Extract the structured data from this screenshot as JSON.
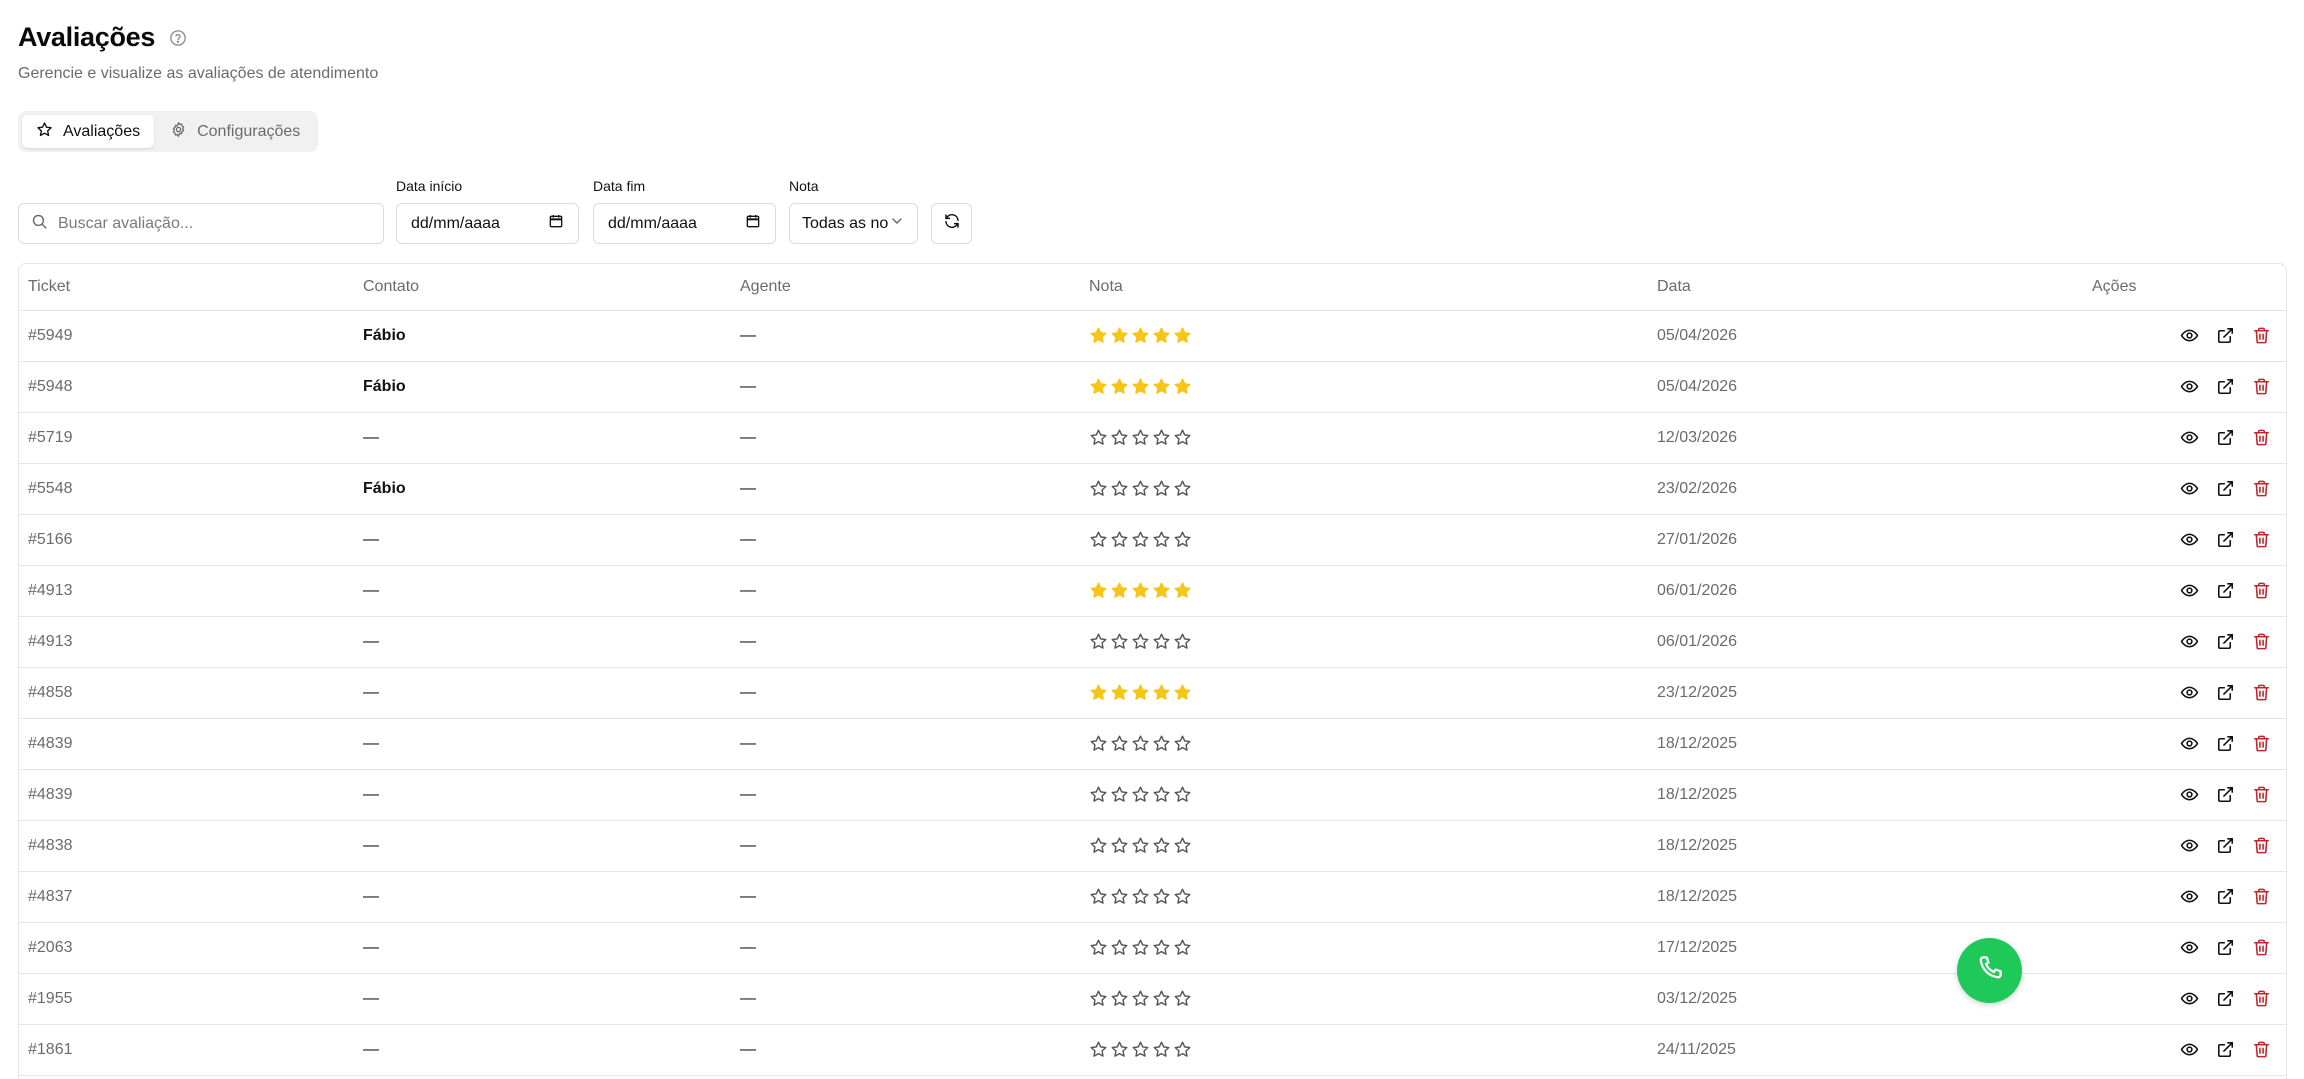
{
  "header": {
    "title": "Avaliações",
    "subtitle": "Gerencie e visualize as avaliações de atendimento"
  },
  "tabs": [
    {
      "label": "Avaliações",
      "icon": "star-icon",
      "active": true
    },
    {
      "label": "Configurações",
      "icon": "gear-icon",
      "active": false
    }
  ],
  "filters": {
    "search_placeholder": "Buscar avaliação...",
    "start_date": {
      "label": "Data início",
      "value": "dd/mm/aaaa"
    },
    "end_date": {
      "label": "Data fim",
      "value": "dd/mm/aaaa"
    },
    "rating": {
      "label": "Nota",
      "value": "Todas as no"
    }
  },
  "table": {
    "columns": [
      "Ticket",
      "Contato",
      "Agente",
      "Nota",
      "Data",
      "Ações"
    ],
    "rows": [
      {
        "ticket": "#5949",
        "contact": "Fábio",
        "agent": "—",
        "rating": 5,
        "date": "05/04/2026"
      },
      {
        "ticket": "#5948",
        "contact": "Fábio",
        "agent": "—",
        "rating": 5,
        "date": "05/04/2026"
      },
      {
        "ticket": "#5719",
        "contact": "—",
        "agent": "—",
        "rating": 0,
        "date": "12/03/2026"
      },
      {
        "ticket": "#5548",
        "contact": "Fábio",
        "agent": "—",
        "rating": 0,
        "date": "23/02/2026"
      },
      {
        "ticket": "#5166",
        "contact": "—",
        "agent": "—",
        "rating": 0,
        "date": "27/01/2026"
      },
      {
        "ticket": "#4913",
        "contact": "—",
        "agent": "—",
        "rating": 5,
        "date": "06/01/2026"
      },
      {
        "ticket": "#4913",
        "contact": "—",
        "agent": "—",
        "rating": 0,
        "date": "06/01/2026"
      },
      {
        "ticket": "#4858",
        "contact": "—",
        "agent": "—",
        "rating": 5,
        "date": "23/12/2025"
      },
      {
        "ticket": "#4839",
        "contact": "—",
        "agent": "—",
        "rating": 0,
        "date": "18/12/2025"
      },
      {
        "ticket": "#4839",
        "contact": "—",
        "agent": "—",
        "rating": 0,
        "date": "18/12/2025"
      },
      {
        "ticket": "#4838",
        "contact": "—",
        "agent": "—",
        "rating": 0,
        "date": "18/12/2025"
      },
      {
        "ticket": "#4837",
        "contact": "—",
        "agent": "—",
        "rating": 0,
        "date": "18/12/2025"
      },
      {
        "ticket": "#2063",
        "contact": "—",
        "agent": "—",
        "rating": 0,
        "date": "17/12/2025"
      },
      {
        "ticket": "#1955",
        "contact": "—",
        "agent": "—",
        "rating": 0,
        "date": "03/12/2025"
      },
      {
        "ticket": "#1861",
        "contact": "—",
        "agent": "—",
        "rating": 0,
        "date": "24/11/2025"
      }
    ]
  },
  "colors": {
    "star_filled": "#f5c518",
    "star_empty": "#555555",
    "delete": "#c0262d",
    "fab": "#1ec95a"
  },
  "icons": {
    "row_actions": [
      "eye-icon",
      "external-link-icon",
      "trash-icon"
    ],
    "fab": "phone-icon",
    "refresh": "refresh-icon",
    "calendar": "calendar-icon",
    "search": "search-icon",
    "help": "help-circle-icon",
    "select": "chevron-down-icon"
  }
}
